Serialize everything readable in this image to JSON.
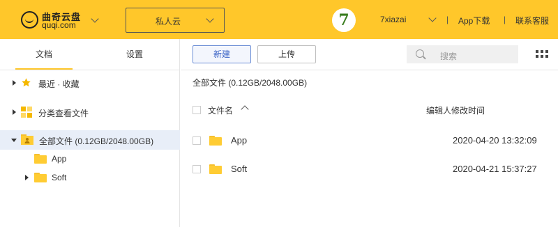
{
  "header": {
    "logo_cn": "曲奇云盘",
    "logo_en": "quqi.com",
    "space_select": "私人云",
    "avatar_text": "7",
    "username": "7xiazai",
    "separator": "|",
    "app_download": "App下载",
    "contact_service": "联系客服"
  },
  "sidebar": {
    "tabs": [
      {
        "label": "文档",
        "active": true
      },
      {
        "label": "设置",
        "active": false
      }
    ],
    "items": [
      {
        "label": "最近 · 收藏",
        "icon": "star-icon"
      },
      {
        "label": "分类查看文件",
        "icon": "category-icon"
      },
      {
        "label": "全部文件 (0.12GB/2048.00GB)",
        "icon": "folder-user-icon",
        "selected": true
      }
    ],
    "children": [
      {
        "label": "App"
      },
      {
        "label": "Soft"
      }
    ]
  },
  "toolbar": {
    "new_label": "新建",
    "upload_label": "上传",
    "search_placeholder": "搜索"
  },
  "main": {
    "breadcrumb": "全部文件 (0.12GB/2048.00GB)",
    "columns": {
      "name": "文件名",
      "modified": "编辑人修改时间"
    },
    "rows": [
      {
        "name": "App",
        "time": "2020-04-20 13:32:09"
      },
      {
        "name": "Soft",
        "time": "2020-04-21 15:37:27"
      }
    ]
  },
  "colors": {
    "brand": "#ffc72a",
    "selected_bg": "#e8eef8",
    "primary_button": "#3b63c6"
  }
}
